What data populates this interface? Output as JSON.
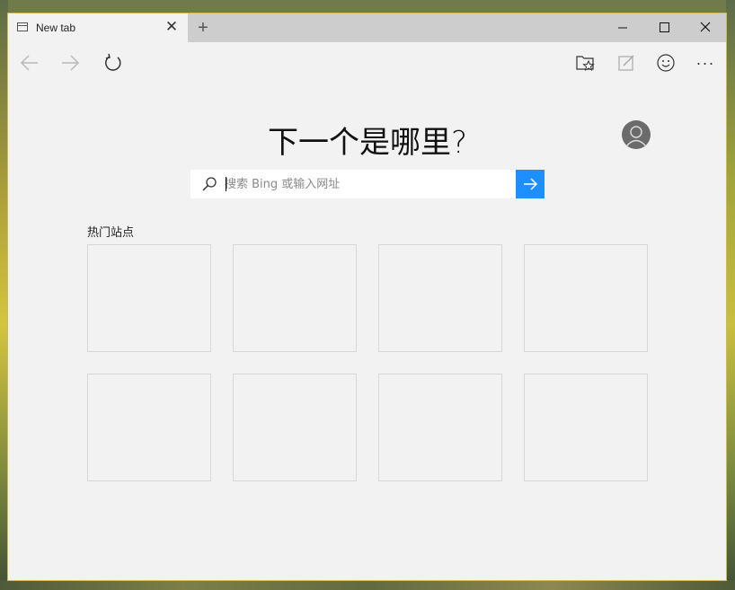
{
  "tab": {
    "title": "New tab",
    "close_glyph": "✕",
    "new_tab_glyph": "+"
  },
  "window_controls": {
    "minimize": "minimize-icon",
    "maximize": "maximize-icon",
    "close": "close-icon"
  },
  "toolbar": {
    "back": "back-arrow-icon",
    "forward": "forward-arrow-icon",
    "refresh": "refresh-icon",
    "hub": "favorites-hub-icon",
    "web_note": "web-note-icon",
    "feedback": "smiley-feedback-icon",
    "more": "more-icon",
    "more_glyph": "···"
  },
  "main": {
    "headline": "下一个是哪里?",
    "search": {
      "placeholder": "搜索 Bing 或输入网址",
      "value": ""
    },
    "top_sites_label": "热门站点",
    "tiles": [
      "",
      "",
      "",
      "",
      "",
      "",
      "",
      ""
    ]
  },
  "colors": {
    "accent": "#1e8fff",
    "frame": "#d4b94a",
    "tabstrip": "#cdcdcd",
    "background": "#f2f2f2"
  }
}
